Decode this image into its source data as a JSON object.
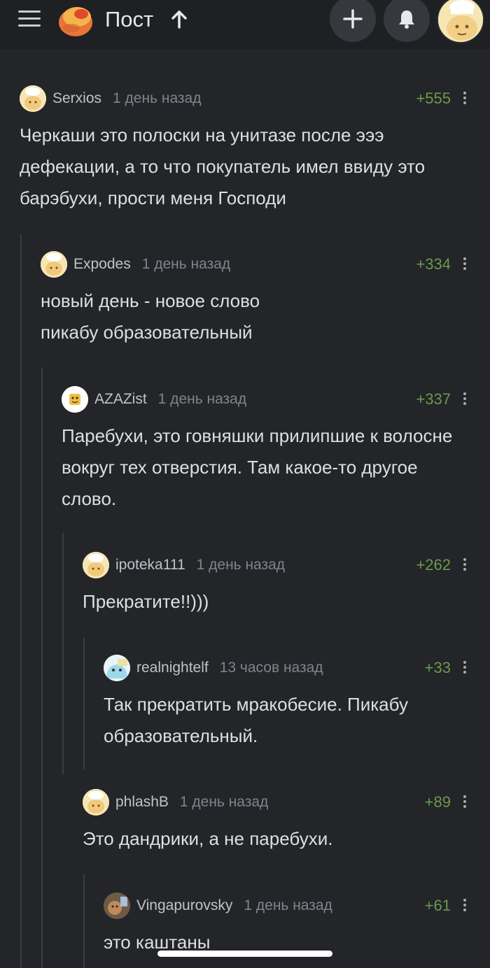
{
  "header": {
    "title": "Пост",
    "icons": [
      "menu-icon",
      "pikabu-logo",
      "arrow-up-icon",
      "plus-icon",
      "bell-icon",
      "user-avatar"
    ]
  },
  "comments": [
    {
      "username": "Serxios",
      "time": "1 день назад",
      "rating": "+555",
      "text": "Черкаши это полоски на унитазе после эээ дефекации, а то что покупатель имел ввиду это барэбухи, прости меня Господи"
    },
    {
      "username": "Expodes",
      "time": "1 день назад",
      "rating": "+334",
      "text": "новый день - новое слово\nпикабу образовательный"
    },
    {
      "username": "AZAZist",
      "time": "1 день назад",
      "rating": "+337",
      "text": "Паребухи, это говняшки прилипшие к волосне вокруг тех отверстия. Там какое-то другое слово."
    },
    {
      "username": "ipoteka111",
      "time": "1 день назад",
      "rating": "+262",
      "text": "Прекратите!!)))"
    },
    {
      "username": "realnightelf",
      "time": "13 часов назад",
      "rating": "+33",
      "text": "Так прекратить мракобесие. Пикабу образовательный."
    },
    {
      "username": "phlashB",
      "time": "1 день назад",
      "rating": "+89",
      "text": "Это дандрики, а не паребухи."
    },
    {
      "username": "Vingapurovsky",
      "time": "1 день назад",
      "rating": "+61",
      "text": "это каштаны"
    }
  ],
  "colors": {
    "background": "#232529",
    "header": "#1e2023",
    "rating": "#6a9a4a",
    "username": "#bfc3c8",
    "timestamp": "#7f858c"
  }
}
